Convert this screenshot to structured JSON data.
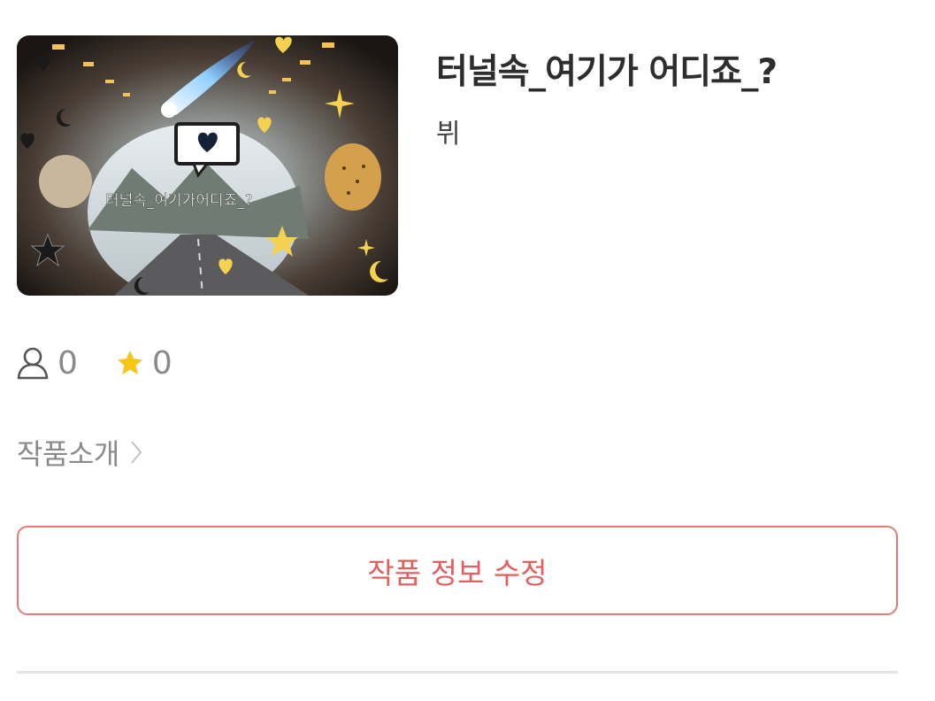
{
  "work": {
    "title": "터널속_여기가 어디죠_?",
    "author": "뷔",
    "cover": {
      "caption": "터널속_여기가어디죠_?",
      "icon": "cover-image"
    }
  },
  "stats": {
    "readers": {
      "icon": "person-icon",
      "value": "0"
    },
    "favorites": {
      "icon": "star-icon",
      "value": "0"
    }
  },
  "intro": {
    "label": "작품소개",
    "icon": "chevron-right-icon"
  },
  "actions": {
    "edit_label": "작품 정보 수정"
  },
  "colors": {
    "accent": "#e0605f",
    "accent_border": "#e47b79",
    "star": "#f5c518",
    "muted": "#8a8a8a"
  }
}
